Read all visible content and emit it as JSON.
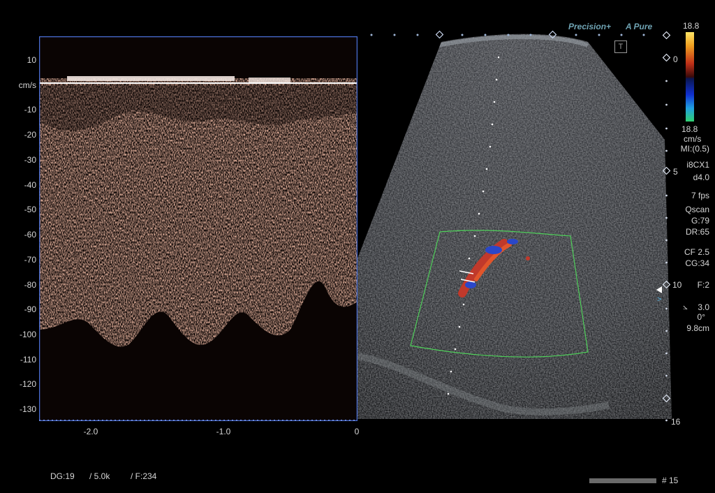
{
  "doppler": {
    "y_unit": "cm/s",
    "y_ticks": [
      "10",
      "-10",
      "-20",
      "-30",
      "-40",
      "-50",
      "-60",
      "-70",
      "-80",
      "-90",
      "-100",
      "-110",
      "-120",
      "-130"
    ],
    "x_ticks": [
      "-2.0",
      "-1.0",
      "0"
    ]
  },
  "bottom_info": {
    "dg": "DG:19",
    "prf": "/ 5.0k",
    "frame": "/ F:234"
  },
  "frame_counter": "# 15",
  "brand": {
    "precision": "Precision+",
    "apure": "A Pure"
  },
  "colorbar": {
    "top": "18.8",
    "zero": "0",
    "bottom": "18.8",
    "unit": "cm/s"
  },
  "depth_marks": [
    "5",
    "10",
    "16"
  ],
  "params": {
    "mi": "MI:(0.5)",
    "probe": "i8CX1",
    "depth": "d4.0",
    "fps": "7 fps",
    "qscan": "Qscan",
    "gain": "G:79",
    "dr": "DR:65",
    "cf": "CF 2.5",
    "cg": "CG:34",
    "focus": "F:2",
    "angle_corr": "3.0",
    "angle": "0°",
    "dist": "9.8cm"
  },
  "colors": {
    "doppler_frame": "#4a6fd6",
    "flow_box": "#4fcf5a",
    "spectrum": "#d77a5a"
  }
}
